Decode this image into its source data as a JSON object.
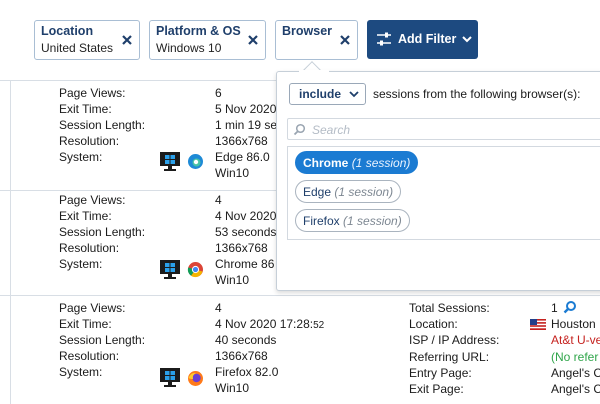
{
  "filters": [
    {
      "title": "Location",
      "value": "United States"
    },
    {
      "title": "Platform & OS",
      "value": "Windows 10"
    },
    {
      "title": "Browser",
      "value": ""
    }
  ],
  "add_filter_label": "Add Filter",
  "labels": {
    "page_views": "Page Views:",
    "exit_time": "Exit Time:",
    "session_length": "Session Length:",
    "resolution": "Resolution:",
    "system": "System:"
  },
  "sessions": [
    {
      "page_views": "6",
      "exit_time": "5 Nov 2020",
      "session_length": "1 min 19 se",
      "resolution": "1366x768",
      "browser": "Edge 86.0",
      "os": "Win10"
    },
    {
      "page_views": "4",
      "exit_time": "4 Nov 2020",
      "session_length": "53 seconds",
      "resolution": "1366x768",
      "browser": "Chrome 86",
      "os": "Win10"
    },
    {
      "page_views": "4",
      "exit_time": "4 Nov 2020 17:28:",
      "exit_time_sec": "52",
      "session_length": "40 seconds",
      "resolution": "1366x768",
      "browser": "Firefox 82.0",
      "os": "Win10"
    }
  ],
  "details": {
    "labels": {
      "total_sessions": "Total Sessions:",
      "location": "Location:",
      "isp": "ISP / IP Address:",
      "referring_url": "Referring URL:",
      "entry_page": "Entry Page:",
      "exit_page": "Exit Page:"
    },
    "values": {
      "total_sessions": "1",
      "location": "Houston",
      "isp": "At&t U-ve",
      "referring_url": "(No refer",
      "entry_page": "Angel's C",
      "exit_page": "Angel's C"
    }
  },
  "popup": {
    "mode": "include",
    "text": "sessions from the following browser(s):",
    "search_placeholder": "Search",
    "browsers": [
      {
        "name": "Chrome",
        "count": "(1 session)",
        "selected": true
      },
      {
        "name": "Edge",
        "count": "(1 session)",
        "selected": false
      },
      {
        "name": "Firefox",
        "count": "(1 session)",
        "selected": false
      }
    ]
  },
  "colors": {
    "primary": "#1d4a80",
    "chip_border": "#a9bed4",
    "selected_pill": "#1b7bd2",
    "link_red": "#c5221f",
    "link_green": "#2fa54a"
  },
  "icons": {
    "windows": "windows-icon",
    "desktop": "desktop-icon",
    "edge": "edge-icon",
    "chrome": "chrome-icon",
    "firefox": "firefox-icon",
    "flag": "us-flag-icon",
    "search": "search-icon"
  }
}
